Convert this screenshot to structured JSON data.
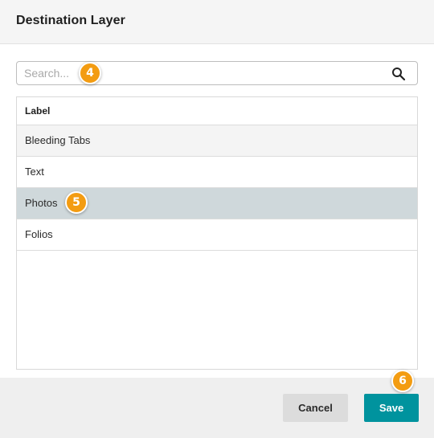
{
  "dialog": {
    "title": "Destination Layer"
  },
  "search": {
    "placeholder": "Search...",
    "value": "",
    "icon": "search-icon"
  },
  "list": {
    "header": "Label",
    "items": [
      {
        "label": "Bleeding Tabs"
      },
      {
        "label": "Text"
      },
      {
        "label": "Photos"
      },
      {
        "label": "Folios"
      }
    ],
    "selected_item": "Photos"
  },
  "footer": {
    "cancel_label": "Cancel",
    "save_label": "Save"
  },
  "callouts": {
    "search": "4",
    "selected_row": "5",
    "save": "6"
  },
  "colors": {
    "accent": "#00939e",
    "selected_row": "#cfd8db",
    "callout": "#f39c12"
  }
}
